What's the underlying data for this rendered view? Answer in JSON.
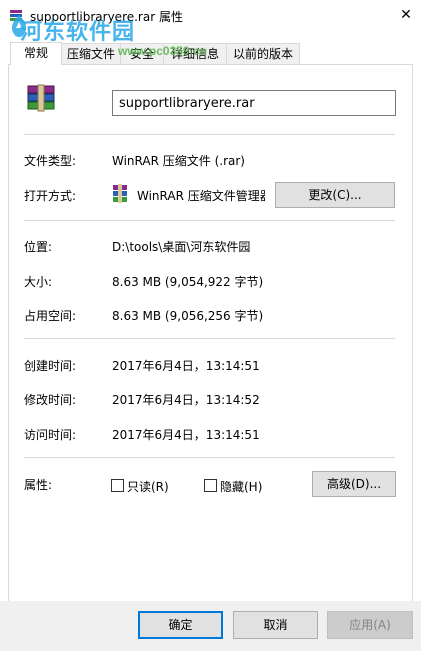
{
  "window": {
    "title": "supportlibraryere.rar 属性",
    "close_glyph": "✕"
  },
  "watermark": {
    "brand": "河东软件园",
    "url": "www.pc0359.cn"
  },
  "tabs": [
    {
      "label": "常规",
      "active": true
    },
    {
      "label": "压缩文件",
      "active": false
    },
    {
      "label": "安全",
      "active": false
    },
    {
      "label": "详细信息",
      "active": false
    },
    {
      "label": "以前的版本",
      "active": false
    }
  ],
  "general": {
    "file_name": "supportlibraryere.rar",
    "file_type_label": "文件类型:",
    "file_type_value": "WinRAR 压缩文件 (.rar)",
    "opens_with_label": "打开方式:",
    "opens_with_value": "WinRAR 压缩文件管理器",
    "change_button": "更改(C)...",
    "location_label": "位置:",
    "location_value": "D:\\tools\\桌面\\河东软件园",
    "size_label": "大小:",
    "size_value": "8.63 MB (9,054,922 字节)",
    "size_on_disk_label": "占用空间:",
    "size_on_disk_value": "8.63 MB (9,056,256 字节)",
    "created_label": "创建时间:",
    "created_value": "2017年6月4日，13:14:51",
    "modified_label": "修改时间:",
    "modified_value": "2017年6月4日，13:14:52",
    "accessed_label": "访问时间:",
    "accessed_value": "2017年6月4日，13:14:51",
    "attributes_label": "属性:",
    "readonly_label": "只读(R)",
    "readonly_checked": false,
    "hidden_label": "隐藏(H)",
    "hidden_checked": false,
    "advanced_button": "高级(D)..."
  },
  "footer": {
    "ok_button": "确定",
    "cancel_button": "取消",
    "apply_button": "应用(A)"
  },
  "colors": {
    "accent": "#0078d7",
    "watermark_blue": "#2aa8e8",
    "watermark_green": "#55b44a"
  }
}
